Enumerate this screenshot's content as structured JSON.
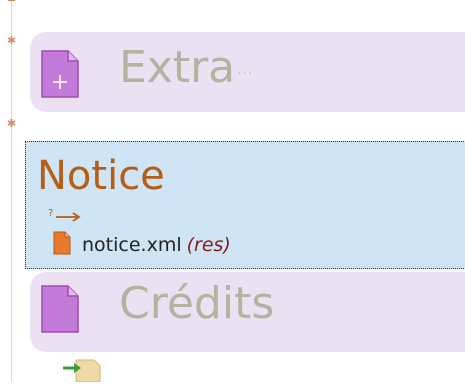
{
  "tree": {
    "sections": [
      {
        "label": "Extra",
        "ellipsis": "..."
      },
      {
        "label": "Crédits"
      }
    ],
    "selected": {
      "title": "Notice",
      "relation_icon": "unknown-link-arrow-icon",
      "file": {
        "name": "notice.xml",
        "tag": "(res)",
        "icon": "document-orange-icon"
      }
    },
    "footer_icon": "import-arrow-icon"
  },
  "colors": {
    "section_bg": "#ece1f3",
    "section_label": "#b7b2a0",
    "selected_bg": "#cfe4f4",
    "selected_title": "#b45f18",
    "doc_icon": "#c37ad8",
    "file_icon": "#e8792a",
    "tag": "#8a1a1a"
  }
}
